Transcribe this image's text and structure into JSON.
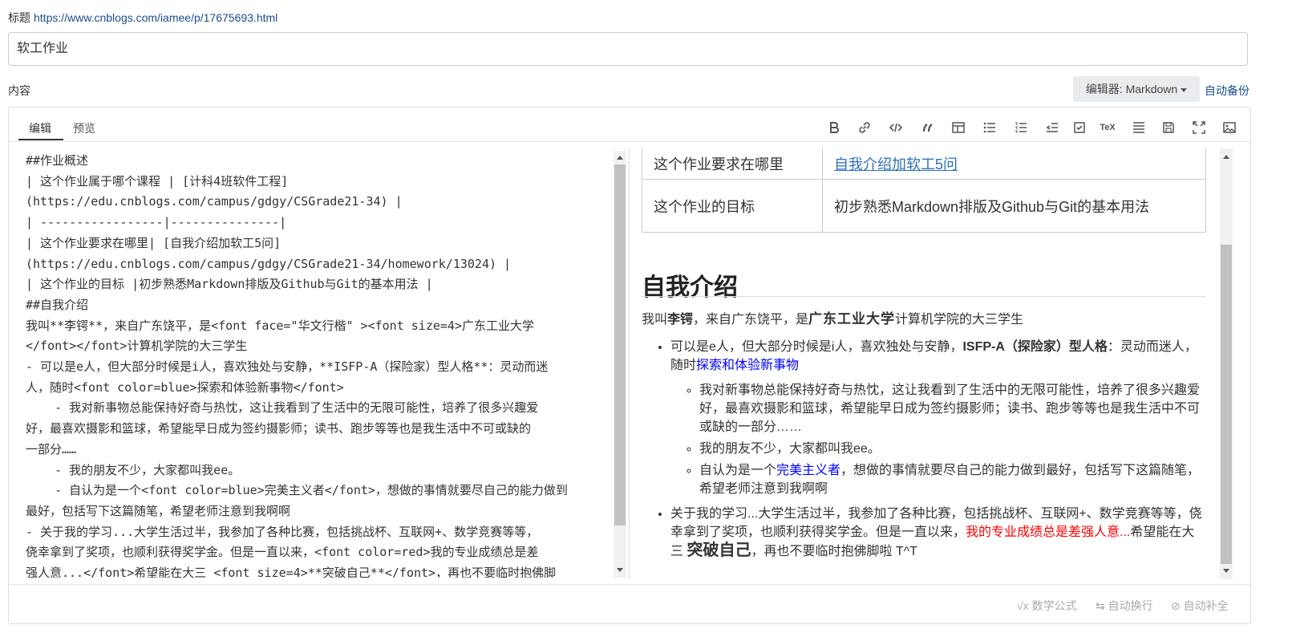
{
  "header": {
    "title_label": "标题",
    "title_url": "https://www.cnblogs.com/iamee/p/17675693.html",
    "title_value": "软工作业",
    "content_label": "内容",
    "editor_button": "编辑器: Markdown",
    "autobackup": "自动备份"
  },
  "tabs": [
    {
      "label": "编辑"
    },
    {
      "label": "预览"
    }
  ],
  "toolbar": [
    "bold-icon",
    "link-icon",
    "code-icon",
    "quote-icon",
    "table-icon",
    "unordered-list-icon",
    "ordered-list-icon",
    "outdent-icon",
    "checkbox-icon",
    "tex-icon",
    "justify-icon",
    "save-icon",
    "fullscreen-icon",
    "image-icon"
  ],
  "tex_label": "TeX",
  "editor_lines": [
    "##作业概述",
    "| 这个作业属于哪个课程 | [计科4班软件工程]",
    "(https://edu.cnblogs.com/campus/gdgy/CSGrade21-34) |",
    "| -----------------|---------------|",
    "| 这个作业要求在哪里| [自我介绍加软工5问]",
    "(https://edu.cnblogs.com/campus/gdgy/CSGrade21-34/homework/13024) |",
    "| 这个作业的目标 |初步熟悉Markdown排版及Github与Git的基本用法 |",
    "##自我介绍",
    "我叫**李锷**，来自广东饶平，是<font face=\"华文行楷\" ><font size=4>广东工业大学",
    "</font></font>计算机学院的大三学生",
    "- 可以是e人，但大部分时候是i人，喜欢独处与安静，**ISFP-A（探险家）型人格**：灵动而迷",
    "人，随时<font color=blue>探索和体验新事物</font>",
    "    - 我对新事物总能保持好奇与热忱，这让我看到了生活中的无限可能性，培养了很多兴趣爱",
    "好，最喜欢摄影和篮球，希望能早日成为签约摄影师；读书、跑步等等也是我生活中不可或缺的",
    "一部分……",
    "    - 我的朋友不少，大家都叫我ee。",
    "    - 自认为是一个<font color=blue>完美主义者</font>，想做的事情就要尽自己的能力做到",
    "最好，包括写下这篇随笔，希望老师注意到我啊啊",
    "- 关于我的学习...大学生活过半，我参加了各种比赛，包括挑战杯、互联网+、数学竞赛等等，",
    "侥幸拿到了奖项，也顺利获得奖学金。但是一直以来，<font color=red>我的专业成绩总是差",
    "强人意...</font>希望能在大三 <font size=4>**突破自己**</font>，再也不要临时抱佛脚"
  ],
  "preview": {
    "table": [
      {
        "col1": "这个作业要求在哪里",
        "col2": "自我介绍加软工5问",
        "col2_link": true
      },
      {
        "col1": "这个作业的目标",
        "col2": "初步熟悉Markdown排版及Github与Git的基本用法",
        "col2_link": false
      }
    ],
    "heading": "自我介绍",
    "intro_pre": "我叫",
    "intro_bold": "李锷",
    "intro_mid": "，来自广东饶平，是",
    "intro_school": "广东工业大学",
    "intro_post": "计算机学院的大三学生",
    "li1_pre": "可以是e人，但大部分时候是i人，喜欢独处与安静，",
    "li1_bold": "ISFP-A（探险家）型人格",
    "li1_mid": "：灵动而迷人，随时",
    "li1_blue": "探索和体验新事物",
    "sub1": "我对新事物总能保持好奇与热忱，这让我看到了生活中的无限可能性，培养了很多兴趣爱好，最喜欢摄影和篮球，希望能早日成为签约摄影师；读书、跑步等等也是我生活中不可或缺的一部分……",
    "sub2": "我的朋友不少，大家都叫我ee。",
    "sub3_pre": "自认为是一个",
    "sub3_blue": "完美主义者",
    "sub3_post": "，想做的事情就要尽自己的能力做到最好，包括写下这篇随笔，希望老师注意到我啊啊",
    "li2_pre": "关于我的学习...大学生活过半，我参加了各种比赛，包括挑战杯、互联网+、数学竞赛等等，侥幸拿到了奖项，也顺利获得奖学金。但是一直以来，",
    "li2_red": "我的专业成绩总是差强人意...",
    "li2_mid": "希望能在大三 ",
    "li2_big": "突破自己",
    "li2_post": "，再也不要临时抱佛脚啦 T^T"
  },
  "footer": {
    "math": "数学公式",
    "wrap": "自动换行",
    "autocomplete": "自动补全"
  },
  "colors": {
    "link": "#1a4d8f",
    "blue": "#0000ff",
    "red": "#ff0000"
  }
}
